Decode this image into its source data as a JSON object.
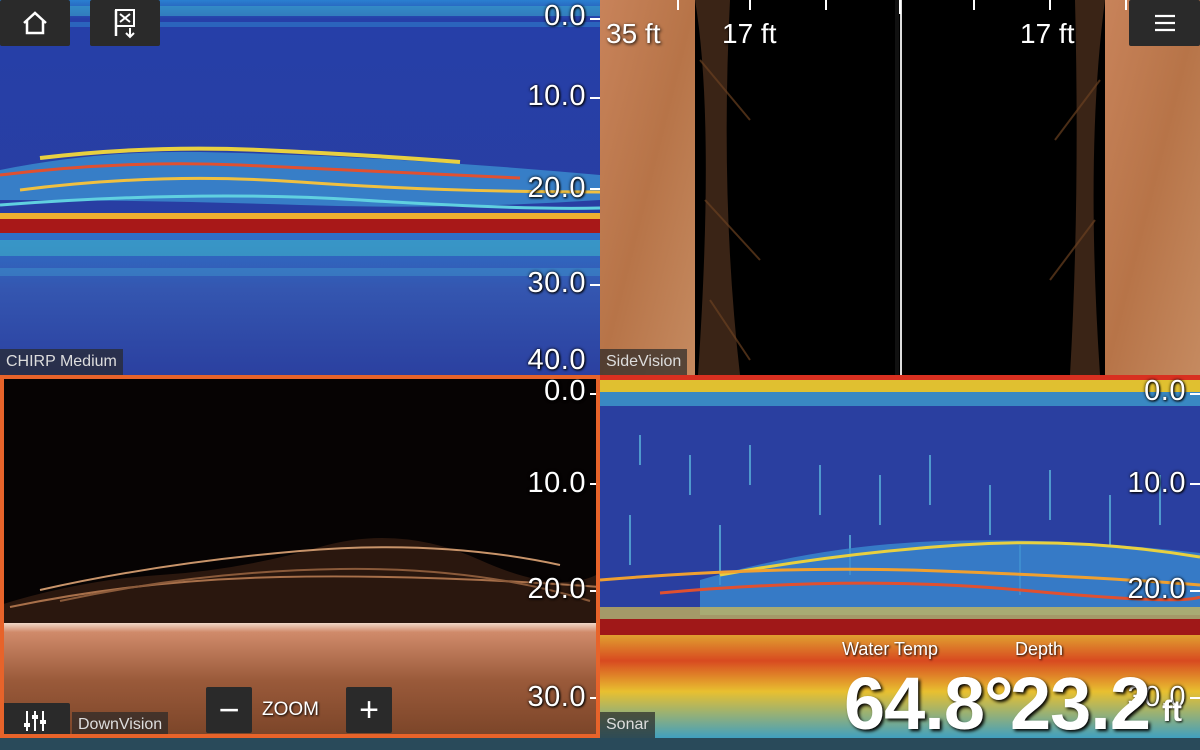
{
  "panes": {
    "chirp": {
      "label": "CHIRP Medium",
      "scale": [
        "0.0",
        "10.0",
        "20.0",
        "30.0",
        "40.0"
      ]
    },
    "sidevision": {
      "label": "SideVision",
      "ranges": [
        "35 ft",
        "17 ft",
        "17 ft"
      ]
    },
    "downvision": {
      "label": "DownVision",
      "scale": [
        "0.0",
        "10.0",
        "20.0",
        "30.0"
      ]
    },
    "sonar": {
      "label": "Sonar",
      "scale": [
        "0.0",
        "10.0",
        "20.0",
        "30.0"
      ]
    }
  },
  "zoom": {
    "label": "ZOOM",
    "minus": "−",
    "plus": "+"
  },
  "readouts": {
    "water_temp": {
      "label": "Water Temp",
      "value": "64.8°"
    },
    "depth": {
      "label": "Depth",
      "value": "23.2",
      "unit": "ft"
    }
  },
  "icons": [
    "home-icon",
    "waypoint-icon",
    "menu-icon",
    "sliders-icon"
  ],
  "colors": {
    "focus_border": "#e7632a",
    "sonar_water": "#2a3fa0",
    "bottom_band": "#a01818"
  }
}
